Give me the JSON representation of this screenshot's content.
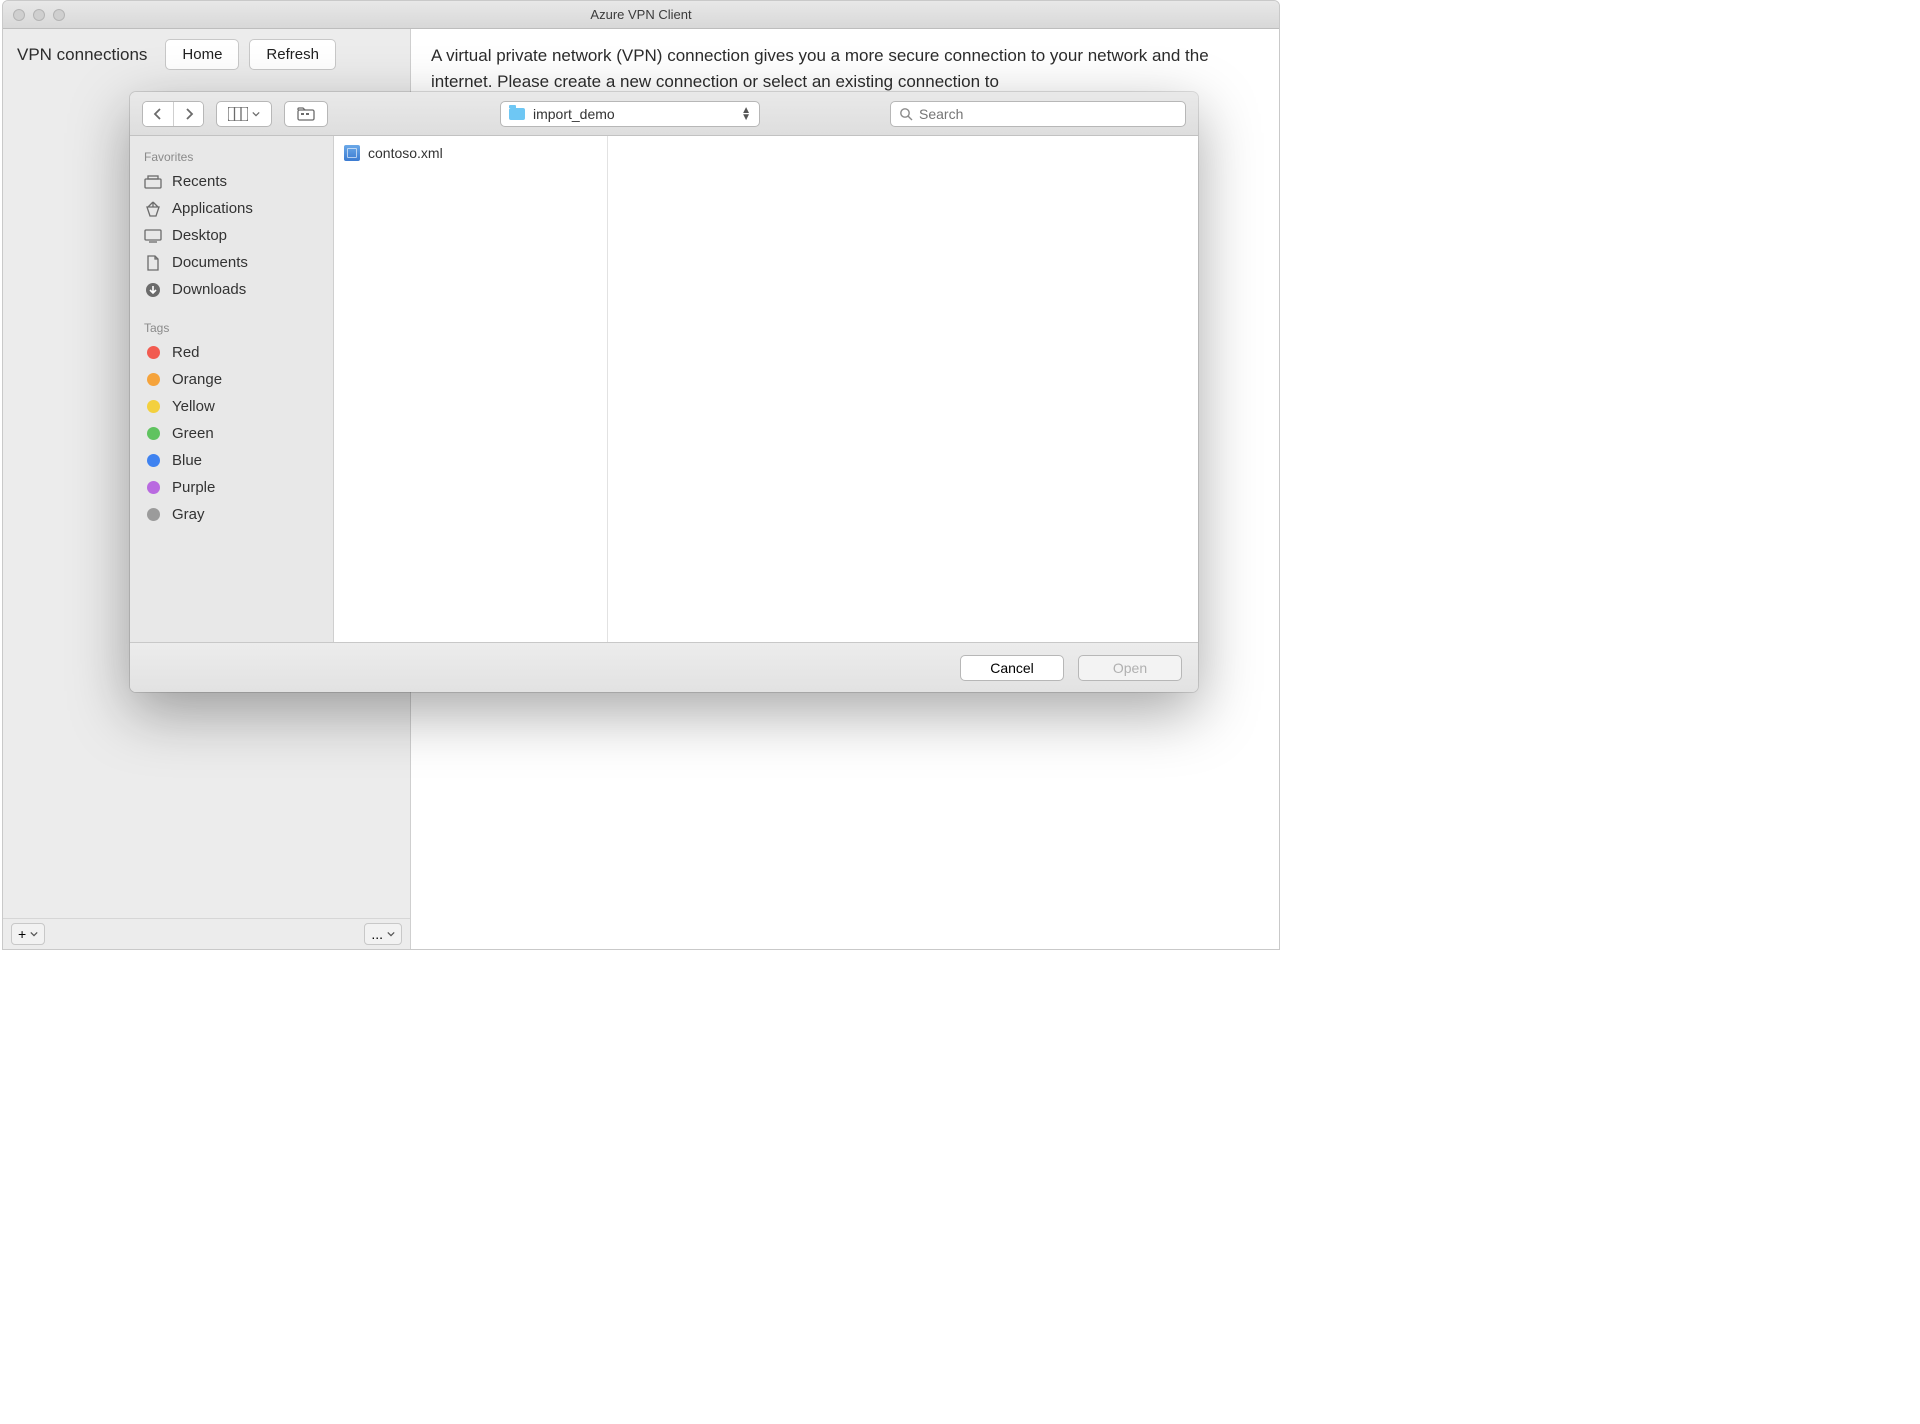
{
  "window": {
    "title": "Azure VPN Client"
  },
  "sidebar": {
    "title": "VPN connections",
    "home_label": "Home",
    "refresh_label": "Refresh"
  },
  "content": {
    "description": "A virtual private network (VPN) connection gives you a more secure connection to your network and the internet. Please create a new connection or select an existing connection to"
  },
  "footer": {
    "add_label": "+",
    "more_label": "..."
  },
  "file_dialog": {
    "path": "import_demo",
    "search_placeholder": "Search",
    "favorites_label": "Favorites",
    "favorites": [
      {
        "name": "Recents",
        "icon": "recents"
      },
      {
        "name": "Applications",
        "icon": "applications"
      },
      {
        "name": "Desktop",
        "icon": "desktop"
      },
      {
        "name": "Documents",
        "icon": "documents"
      },
      {
        "name": "Downloads",
        "icon": "downloads"
      }
    ],
    "tags_label": "Tags",
    "tags": [
      {
        "name": "Red",
        "color": "#f25b50"
      },
      {
        "name": "Orange",
        "color": "#f5a33b"
      },
      {
        "name": "Yellow",
        "color": "#f3d03e"
      },
      {
        "name": "Green",
        "color": "#5fc35f"
      },
      {
        "name": "Blue",
        "color": "#3e82f0"
      },
      {
        "name": "Purple",
        "color": "#b96ae0"
      },
      {
        "name": "Gray",
        "color": "#9b9b9b"
      }
    ],
    "files": [
      {
        "name": "contoso.xml"
      }
    ],
    "cancel_label": "Cancel",
    "open_label": "Open"
  }
}
